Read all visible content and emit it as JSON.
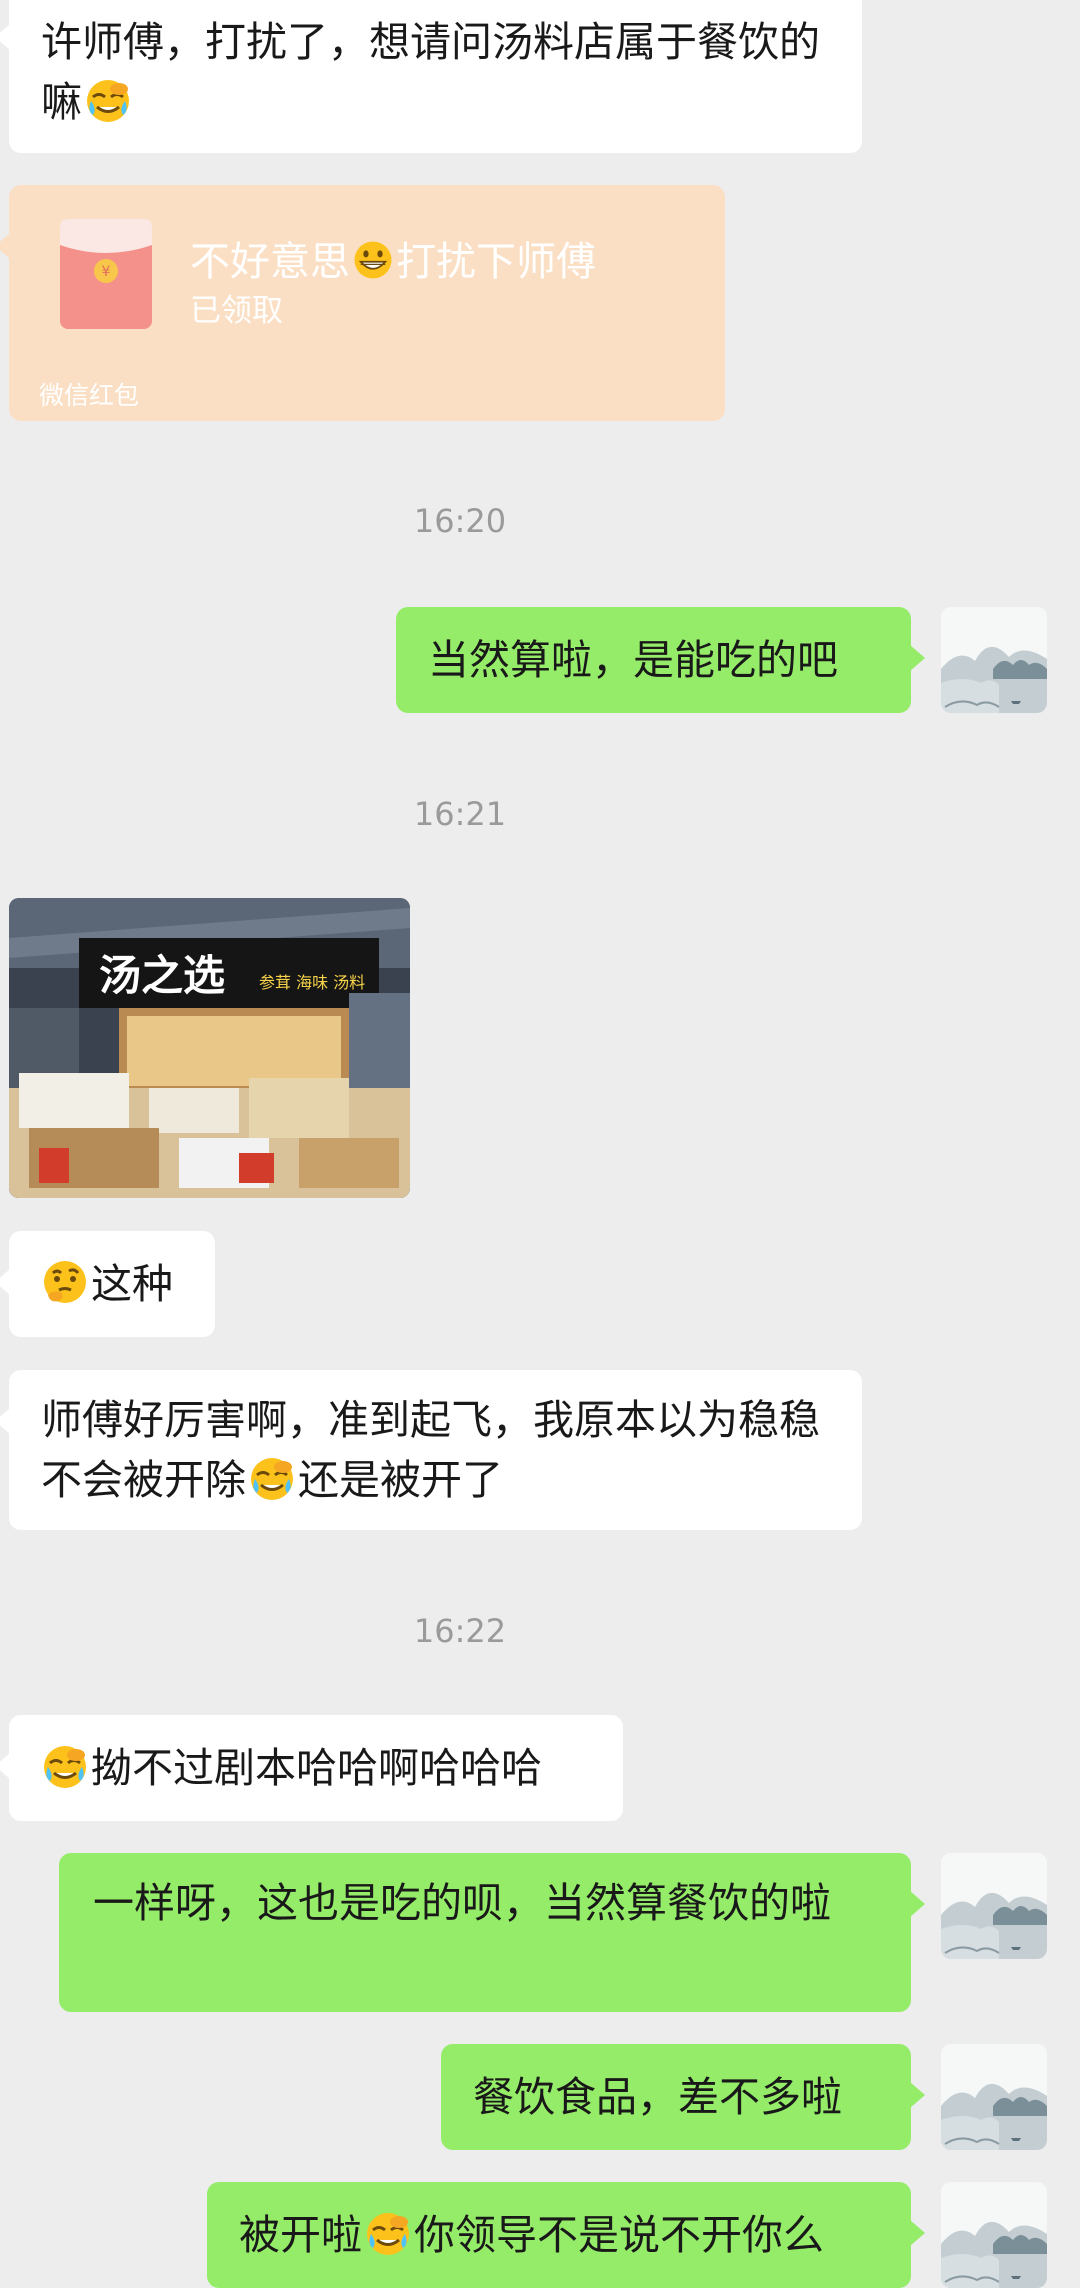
{
  "messages": {
    "m1": {
      "text_a": "许师傅，打扰了，想请问汤料店属于餐饮的嘛"
    },
    "redpacket": {
      "title_a": "不好意思",
      "title_b": "打扰下师傅",
      "status": "已领取",
      "footer": "微信红包",
      "icon": "red-envelope-icon"
    },
    "t1": "16:20",
    "m2": {
      "text": "当然算啦，是能吃的吧"
    },
    "t2": "16:21",
    "photo": {
      "sign_title": "汤之选",
      "sign_sub": "参茸 海味 汤料"
    },
    "m3": {
      "text_b": "这种"
    },
    "m4": {
      "text_a": "师傅好厉害啊，准到起飞，我原本以为稳稳不会被开除",
      "text_b": "还是被开了"
    },
    "t3": "16:22",
    "m5": {
      "text_b": "拗不过剧本哈哈啊哈哈哈"
    },
    "m6": {
      "text": "一样呀，这也是吃的呗，当然算餐饮的啦"
    },
    "m7": {
      "text": "餐饮食品，差不多啦"
    },
    "m8": {
      "text_a": "被开啦",
      "text_b": "你领导不是说不开你么"
    }
  },
  "colors": {
    "background": "#ededed",
    "incoming_bubble": "#ffffff",
    "outgoing_bubble": "#95ec69",
    "redpacket": "#fbdfc4",
    "time_text": "#9a9a9a"
  },
  "icons": [
    "facepalm-emoji",
    "grin-emoji",
    "thinking-emoji",
    "landscape-avatar",
    "red-envelope-icon"
  ]
}
